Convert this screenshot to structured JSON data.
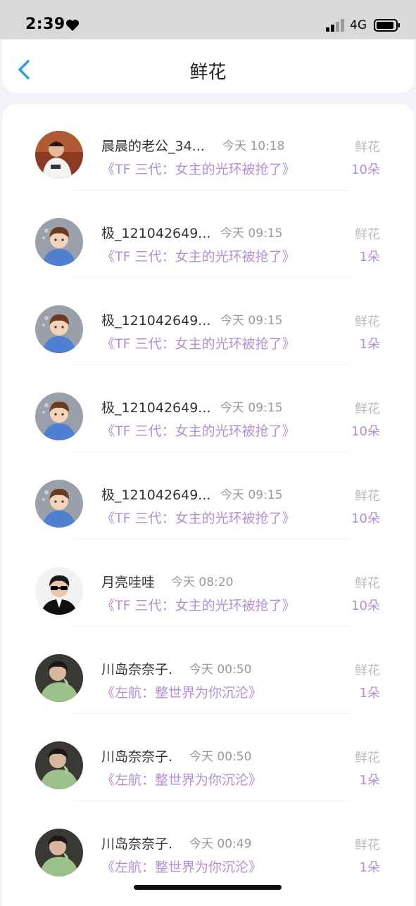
{
  "status_bar": {
    "time": "2:39",
    "network": "4G"
  },
  "header": {
    "title": "鲜花"
  },
  "list": [
    {
      "name": "晨晨的老公_34...",
      "time": "今天 10:18",
      "book": "《TF 三代：女主的光环被抢了》",
      "gift": "鲜花",
      "count": "10朵",
      "avatar": "avatar-boy-red"
    },
    {
      "name": "极_121042649...",
      "time": "今天 09:15",
      "book": "《TF 三代：女主的光环被抢了》",
      "gift": "鲜花",
      "count": "1朵",
      "avatar": "avatar-cartoon-boy"
    },
    {
      "name": "极_121042649...",
      "time": "今天 09:15",
      "book": "《TF 三代：女主的光环被抢了》",
      "gift": "鲜花",
      "count": "1朵",
      "avatar": "avatar-cartoon-boy"
    },
    {
      "name": "极_121042649...",
      "time": "今天 09:15",
      "book": "《TF 三代：女主的光环被抢了》",
      "gift": "鲜花",
      "count": "10朵",
      "avatar": "avatar-cartoon-boy"
    },
    {
      "name": "极_121042649...",
      "time": "今天 09:15",
      "book": "《TF 三代：女主的光环被抢了》",
      "gift": "鲜花",
      "count": "10朵",
      "avatar": "avatar-cartoon-boy"
    },
    {
      "name": "月亮哇哇",
      "time": "今天 08:20",
      "book": "《TF 三代：女主的光环被抢了》",
      "gift": "鲜花",
      "count": "10朵",
      "avatar": "avatar-sunglasses"
    },
    {
      "name": "川岛奈奈子.",
      "time": "今天 00:50",
      "book": "《左航：整世界为你沉沦》",
      "gift": "鲜花",
      "count": "1朵",
      "avatar": "avatar-green-sweater"
    },
    {
      "name": "川岛奈奈子.",
      "time": "今天 00:50",
      "book": "《左航：整世界为你沉沦》",
      "gift": "鲜花",
      "count": "1朵",
      "avatar": "avatar-green-sweater"
    },
    {
      "name": "川岛奈奈子.",
      "time": "今天 00:49",
      "book": "《左航：整世界为你沉沦》",
      "gift": "鲜花",
      "count": "1朵",
      "avatar": "avatar-green-sweater"
    }
  ],
  "colors": {
    "accent": "#b28fd6",
    "back_arrow": "#2b9fe6",
    "muted": "#999999"
  }
}
